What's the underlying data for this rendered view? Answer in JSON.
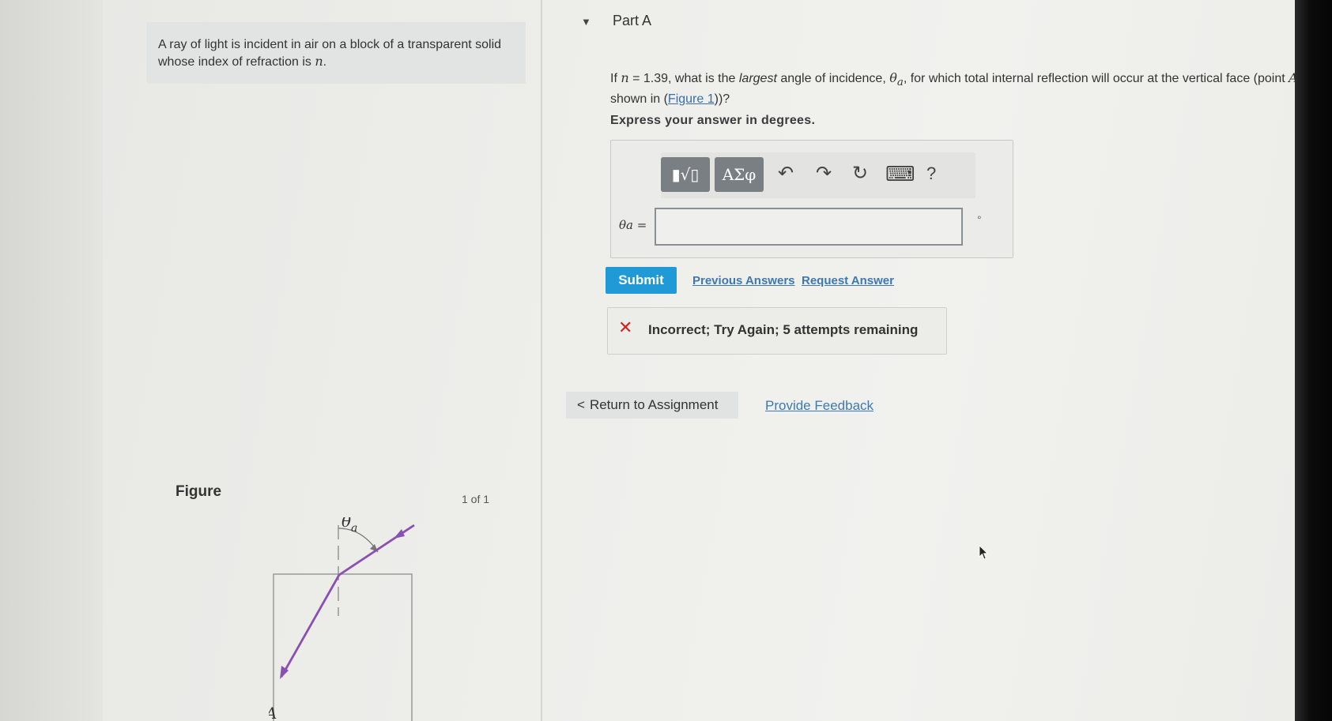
{
  "problem": {
    "text_before": "A ray of light is incident in air on a block of a transparent solid whose index of refraction is ",
    "variable": "n",
    "text_after": "."
  },
  "figure": {
    "label": "Figure",
    "pager": "1 of 1",
    "angle_label": "θ",
    "angle_sub": "a",
    "point_label": "A",
    "ray_color": "#8a4fb3"
  },
  "part": {
    "title": "Part A",
    "caret": "▼"
  },
  "question": {
    "t1": "If ",
    "n": "n",
    "t2": " = 1.39, what is the ",
    "largest": "largest",
    "t3": " angle of incidence, ",
    "theta": "θ",
    "theta_sub": "a",
    "t4": ", for which total internal reflection will occur at the vertical face (point ",
    "pointA": "A",
    "t5": " shown in (",
    "figure_link": "Figure 1",
    "t6": "))?"
  },
  "instruction": "Express your answer in degrees.",
  "toolbar": {
    "templates_icon": "▮√▯",
    "greek": "ΑΣφ",
    "undo_icon": "↶",
    "redo_icon": "↷",
    "reset_icon": "↻",
    "keyboard_icon": "⌨",
    "help": "?"
  },
  "answer": {
    "label": "θa =",
    "value": "",
    "unit": "°"
  },
  "actions": {
    "submit": "Submit",
    "previous_answers": "Previous Answers",
    "request_answer": "Request Answer"
  },
  "feedback": {
    "icon": "✕",
    "text": "Incorrect; Try Again; 5 attempts remaining"
  },
  "nav": {
    "return": "Return to Assignment",
    "return_icon": "<",
    "provide_feedback": "Provide Feedback"
  },
  "colors": {
    "submit_blue": "#1f9ad6",
    "error_red": "#d2231f",
    "link_blue": "#3d78b3"
  }
}
